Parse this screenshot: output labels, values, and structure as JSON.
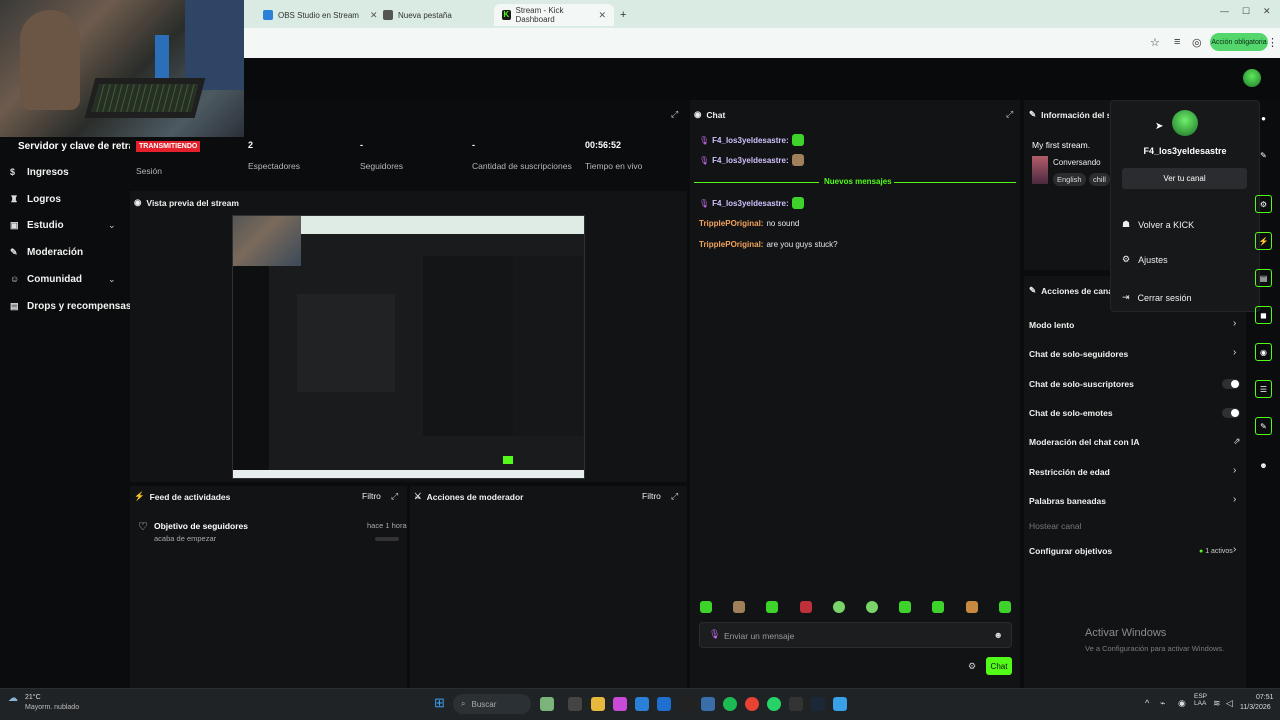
{
  "browser": {
    "tabs": [
      {
        "label": "OBS Studio en Stream"
      },
      {
        "label": "Nueva pestaña"
      },
      {
        "label": "Stream - Kick Dashboard"
      }
    ],
    "action_pill": "Acción obligatoria",
    "new_tab_symbol": "+"
  },
  "sidebar": {
    "stream_key_label": "Servidor y clave de retransmisión",
    "items": [
      {
        "label": "Ingresos",
        "icon": "money-icon"
      },
      {
        "label": "Logros",
        "icon": "trophy-icon"
      },
      {
        "label": "Estudio",
        "icon": "monitor-icon"
      },
      {
        "label": "Moderación",
        "icon": "wrench-icon"
      },
      {
        "label": "Comunidad",
        "icon": "people-icon"
      },
      {
        "label": "Drops y recompensas",
        "icon": "gift-icon"
      }
    ]
  },
  "stats": {
    "live_badge": "TRANSMITIENDO",
    "session_label": "Sesión",
    "viewers_value": "2",
    "viewers_label": "Espectadores",
    "followers_value": "-",
    "followers_label": "Seguidores",
    "subs_value": "-",
    "subs_label": "Cantidad de suscripciones",
    "time_value": "00:56:52",
    "time_label": "Tiempo en vivo"
  },
  "preview": {
    "title": "Vista previa del stream"
  },
  "activity": {
    "title": "Feed de actividades",
    "filter": "Filtro",
    "item_title": "Objetivo de seguidores",
    "item_sub": "acaba de empezar",
    "item_time": "hace 1 hora"
  },
  "modactions": {
    "title": "Acciones de moderador",
    "filter": "Filtro"
  },
  "chat": {
    "title": "Chat",
    "messages_top": [
      {
        "user": "F4_los3yeldesastre:"
      },
      {
        "user": "F4_los3yeldesastre:"
      }
    ],
    "new_messages": "Nuevos mensajes",
    "messages_bottom": [
      {
        "user": "F4_los3yeldesastre:",
        "text": ""
      },
      {
        "user": "TripplePOriginal:",
        "text": "no sound"
      },
      {
        "user": "TripplePOriginal:",
        "text": "are you guys stuck?"
      }
    ],
    "input_placeholder": "Enviar un mensaje",
    "send_button": "Chat"
  },
  "streaminfo": {
    "title": "Información del stream",
    "stream_title": "My first stream.",
    "category": "Conversando",
    "tags": [
      "English",
      "chill"
    ]
  },
  "channel_actions": {
    "title": "Acciones de canal",
    "rows": [
      {
        "label": "Modo lento",
        "control": "chevron"
      },
      {
        "label": "Chat de solo-seguidores",
        "control": "chevron"
      },
      {
        "label": "Chat de solo-suscriptores",
        "control": "toggle"
      },
      {
        "label": "Chat de solo-emotes",
        "control": "toggle"
      },
      {
        "label": "Moderación del chat con IA",
        "control": "external"
      },
      {
        "label": "Restricción de edad",
        "control": "chevron"
      },
      {
        "label": "Palabras baneadas",
        "control": "chevron"
      }
    ],
    "host_label": "Hostear canal",
    "goals_label": "Configurar objetivos",
    "goals_status": "1 activos"
  },
  "user_menu": {
    "username": "F4_los3yeldesastre",
    "view_channel": "Ver tu canal",
    "items": [
      {
        "label": "Volver a KICK",
        "icon": "kick-icon"
      },
      {
        "label": "Ajustes",
        "icon": "gear-icon"
      },
      {
        "label": "Cerrar sesión",
        "icon": "logout-icon"
      }
    ]
  },
  "watermark": {
    "line1": "Activar Windows",
    "line2": "Ve a Configuración para activar Windows."
  },
  "taskbar": {
    "weather_temp": "21°C",
    "weather_desc": "Mayorm. nublado",
    "search": "Buscar",
    "lang": "ESP",
    "lang2": "LAA",
    "time": "07:51",
    "date": "11/3/2026"
  },
  "colors": {
    "accent": "#53fc18",
    "live": "#e3202b"
  }
}
